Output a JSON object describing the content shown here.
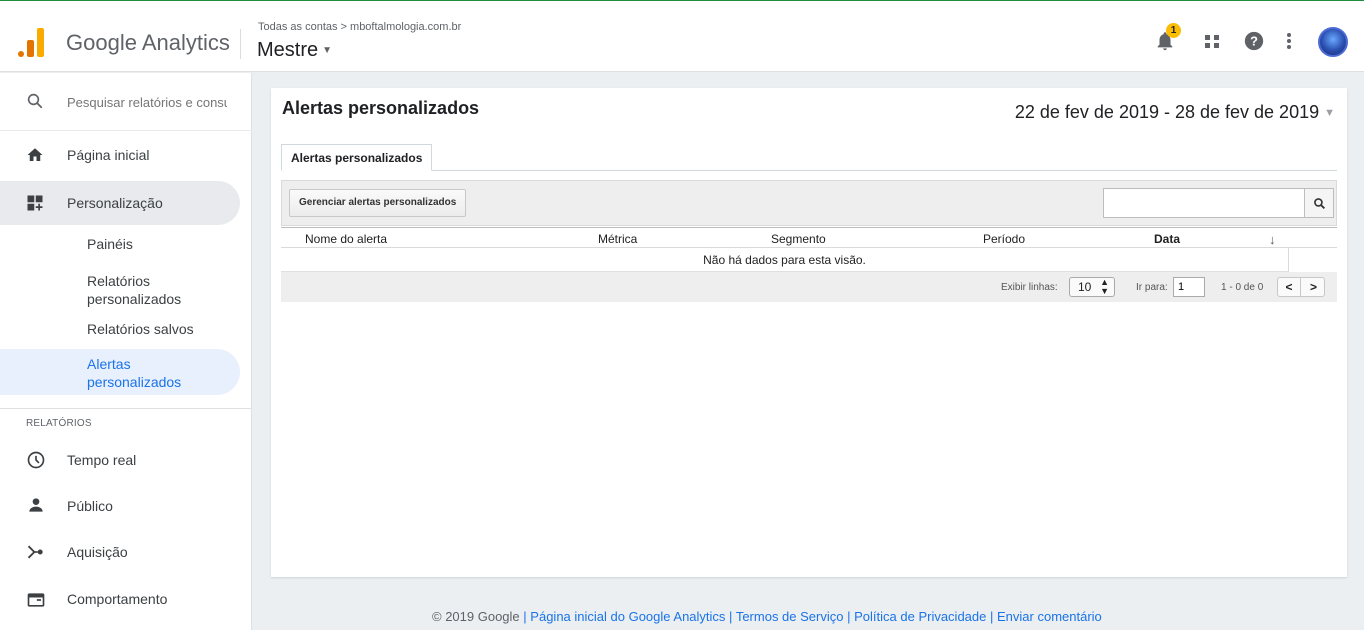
{
  "header": {
    "brand": "Google Analytics",
    "breadcrumb": "Todas as contas > mboftalmologia.com.br",
    "view_name": "Mestre",
    "notification_count": "1"
  },
  "sidebar": {
    "search_placeholder": "Pesquisar relatórios e consu",
    "items": [
      {
        "label": "Página inicial",
        "icon": "home-icon"
      },
      {
        "label": "Personalização",
        "icon": "customization-icon"
      }
    ],
    "subitems": [
      {
        "label": "Painéis"
      },
      {
        "label_line1": "Relatórios",
        "label_line2": "personalizados"
      },
      {
        "label": "Relatórios salvos"
      },
      {
        "label_line1": "Alertas",
        "label_line2": "personalizados"
      }
    ],
    "section_label": "RELATÓRIOS",
    "report_items": [
      {
        "label": "Tempo real",
        "icon": "clock-icon"
      },
      {
        "label": "Público",
        "icon": "person-icon"
      },
      {
        "label": "Aquisição",
        "icon": "acquisition-icon"
      },
      {
        "label": "Comportamento",
        "icon": "behavior-icon"
      }
    ]
  },
  "main": {
    "title": "Alertas personalizados",
    "date_range": "22 de fev de 2019 - 28 de fev de 2019",
    "tab_label": "Alertas personalizados",
    "manage_button": "Gerenciar alertas personalizados",
    "columns": [
      "Nome do alerta",
      "Métrica",
      "Segmento",
      "Período",
      "Data"
    ],
    "empty_message": "Não há dados para esta visão.",
    "pager": {
      "rows_label": "Exibir linhas:",
      "rows_value": "10",
      "goto_label": "Ir para:",
      "goto_value": "1",
      "range_text": "1 - 0 de 0",
      "prev": "<",
      "next": ">"
    }
  },
  "footer": {
    "copyright": "© 2019 Google",
    "links": [
      "Página inicial do Google Analytics",
      "Termos de Serviço",
      "Política de Privacidade",
      "Enviar comentário"
    ],
    "separator": "|"
  },
  "colors": {
    "accent_blue": "#1a73e8",
    "logo_orange": "#e37400",
    "logo_yellow": "#f9ab00",
    "badge_yellow": "#fbbc04"
  }
}
